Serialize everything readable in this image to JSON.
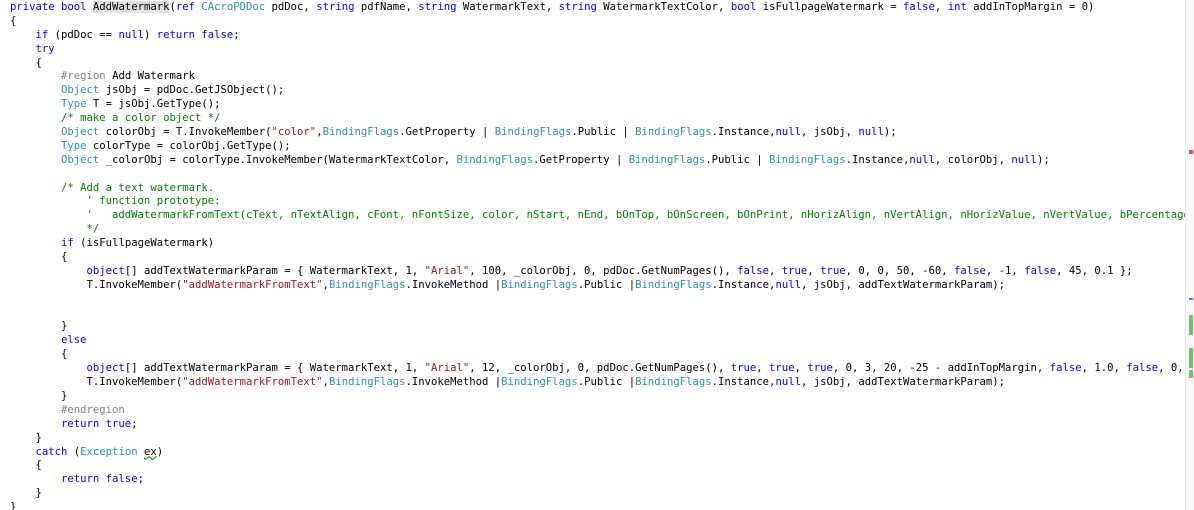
{
  "editor": {
    "lines": [
      [
        [
          "k",
          "private bool "
        ],
        [
          "h",
          "AddWatermark"
        ],
        [
          "p",
          "("
        ],
        [
          "k",
          "ref "
        ],
        [
          "t",
          "CAcroPDDoc"
        ],
        [
          "p",
          " pdDoc, "
        ],
        [
          "k",
          "string"
        ],
        [
          "p",
          " pdfName, "
        ],
        [
          "k",
          "string"
        ],
        [
          "p",
          " WatermarkText, "
        ],
        [
          "k",
          "string"
        ],
        [
          "p",
          " WatermarkTextColor, "
        ],
        [
          "k",
          "bool"
        ],
        [
          "p",
          " isFullpageWatermark = "
        ],
        [
          "k",
          "false"
        ],
        [
          "p",
          ", "
        ],
        [
          "k",
          "int"
        ],
        [
          "p",
          " addInTopMargin = 0)"
        ]
      ],
      [
        [
          "p",
          "{"
        ]
      ],
      [
        [
          "p",
          "    "
        ],
        [
          "k",
          "if"
        ],
        [
          "p",
          " (pdDoc == "
        ],
        [
          "k",
          "null"
        ],
        [
          "p",
          ") "
        ],
        [
          "k",
          "return false"
        ],
        [
          "p",
          ";"
        ]
      ],
      [
        [
          "p",
          "    "
        ],
        [
          "k",
          "try"
        ]
      ],
      [
        [
          "p",
          "    {"
        ]
      ],
      [
        [
          "p",
          "        "
        ],
        [
          "r",
          "#region"
        ],
        [
          "p",
          " Add Watermark"
        ]
      ],
      [
        [
          "p",
          "        "
        ],
        [
          "t",
          "Object"
        ],
        [
          "p",
          " jsObj = pdDoc.GetJSObject();"
        ]
      ],
      [
        [
          "p",
          "        "
        ],
        [
          "t",
          "Type"
        ],
        [
          "p",
          " T = jsObj.GetType();"
        ]
      ],
      [
        [
          "p",
          "        "
        ],
        [
          "c",
          "/* make a color object */"
        ]
      ],
      [
        [
          "p",
          "        "
        ],
        [
          "t",
          "Object"
        ],
        [
          "p",
          " colorObj = T.InvokeMember("
        ],
        [
          "s",
          "\"color\""
        ],
        [
          "p",
          ","
        ],
        [
          "t",
          "BindingFlags"
        ],
        [
          "p",
          ".GetProperty | "
        ],
        [
          "t",
          "BindingFlags"
        ],
        [
          "p",
          ".Public | "
        ],
        [
          "t",
          "BindingFlags"
        ],
        [
          "p",
          ".Instance,"
        ],
        [
          "k",
          "null"
        ],
        [
          "p",
          ", jsObj, "
        ],
        [
          "k",
          "null"
        ],
        [
          "p",
          ");"
        ]
      ],
      [
        [
          "p",
          "        "
        ],
        [
          "t",
          "Type"
        ],
        [
          "p",
          " colorType = colorObj.GetType();"
        ]
      ],
      [
        [
          "p",
          "        "
        ],
        [
          "t",
          "Object"
        ],
        [
          "p",
          " _colorObj = colorType.InvokeMember(WatermarkTextColor, "
        ],
        [
          "t",
          "BindingFlags"
        ],
        [
          "p",
          ".GetProperty | "
        ],
        [
          "t",
          "BindingFlags"
        ],
        [
          "p",
          ".Public | "
        ],
        [
          "t",
          "BindingFlags"
        ],
        [
          "p",
          ".Instance,"
        ],
        [
          "k",
          "null"
        ],
        [
          "p",
          ", colorObj, "
        ],
        [
          "k",
          "null"
        ],
        [
          "p",
          ");"
        ]
      ],
      [
        [
          "p",
          ""
        ]
      ],
      [
        [
          "p",
          "        "
        ],
        [
          "c",
          "/* Add a text watermark."
        ]
      ],
      [
        [
          "c",
          "            ' function prototype:"
        ]
      ],
      [
        [
          "c",
          "            '   addWatermarkFromText(cText, nTextAlign, cFont, nFontSize, color, nStart, nEnd, bOnTop, bOnScreen, bOnPrint, nHorizAlign, nVertAlign, nHorizValue, nVertValue, bPercentage, nScale, bFixedPrint, nRotation, nOpacity)"
        ]
      ],
      [
        [
          "c",
          "            */"
        ]
      ],
      [
        [
          "p",
          "        "
        ],
        [
          "k",
          "if"
        ],
        [
          "p",
          " (isFullpageWatermark)"
        ]
      ],
      [
        [
          "p",
          "        {"
        ]
      ],
      [
        [
          "p",
          "            "
        ],
        [
          "k",
          "object"
        ],
        [
          "p",
          "[] addTextWatermarkParam = { WatermarkText, 1, "
        ],
        [
          "s",
          "\"Arial\""
        ],
        [
          "p",
          ", 100, _colorObj, 0, pdDoc.GetNumPages(), "
        ],
        [
          "k",
          "false"
        ],
        [
          "p",
          ", "
        ],
        [
          "k",
          "true"
        ],
        [
          "p",
          ", "
        ],
        [
          "k",
          "true"
        ],
        [
          "p",
          ", 0, 0, 50, -60, "
        ],
        [
          "k",
          "false"
        ],
        [
          "p",
          ", -1, "
        ],
        [
          "k",
          "false"
        ],
        [
          "p",
          ", 45, 0.1 };"
        ]
      ],
      [
        [
          "p",
          "            T.InvokeMember("
        ],
        [
          "s",
          "\"addWatermarkFromText\""
        ],
        [
          "p",
          ","
        ],
        [
          "t",
          "BindingFlags"
        ],
        [
          "p",
          ".InvokeMethod |"
        ],
        [
          "t",
          "BindingFlags"
        ],
        [
          "p",
          ".Public |"
        ],
        [
          "t",
          "BindingFlags"
        ],
        [
          "p",
          ".Instance,"
        ],
        [
          "k",
          "null"
        ],
        [
          "p",
          ", jsObj, addTextWatermarkParam);"
        ]
      ],
      [
        [
          "p",
          ""
        ]
      ],
      [
        [
          "p",
          ""
        ]
      ],
      [
        [
          "p",
          "        }"
        ]
      ],
      [
        [
          "p",
          "        "
        ],
        [
          "k",
          "else"
        ]
      ],
      [
        [
          "p",
          "        {"
        ]
      ],
      [
        [
          "p",
          "            "
        ],
        [
          "k",
          "object"
        ],
        [
          "p",
          "[] addTextWatermarkParam = { WatermarkText, 1, "
        ],
        [
          "s",
          "\"Arial\""
        ],
        [
          "p",
          ", 12, _colorObj, 0, pdDoc.GetNumPages(), "
        ],
        [
          "k",
          "true"
        ],
        [
          "p",
          ", "
        ],
        [
          "k",
          "true"
        ],
        [
          "p",
          ", "
        ],
        [
          "k",
          "true"
        ],
        [
          "p",
          ", 0, 3, 20, -25 - addInTopMargin, "
        ],
        [
          "k",
          "false"
        ],
        [
          "p",
          ", 1.0, "
        ],
        [
          "k",
          "false"
        ],
        [
          "p",
          ", 0, 0.7 };"
        ]
      ],
      [
        [
          "p",
          "            T.InvokeMember("
        ],
        [
          "s",
          "\"addWatermarkFromText\""
        ],
        [
          "p",
          ","
        ],
        [
          "t",
          "BindingFlags"
        ],
        [
          "p",
          ".InvokeMethod |"
        ],
        [
          "t",
          "BindingFlags"
        ],
        [
          "p",
          ".Public |"
        ],
        [
          "t",
          "BindingFlags"
        ],
        [
          "p",
          ".Instance,"
        ],
        [
          "k",
          "null"
        ],
        [
          "p",
          ", jsObj, addTextWatermarkParam);"
        ]
      ],
      [
        [
          "p",
          "        }"
        ]
      ],
      [
        [
          "p",
          "        "
        ],
        [
          "r",
          "#endregion"
        ]
      ],
      [
        [
          "p",
          "        "
        ],
        [
          "k",
          "return true"
        ],
        [
          "p",
          ";"
        ]
      ],
      [
        [
          "p",
          "    }"
        ]
      ],
      [
        [
          "p",
          "    "
        ],
        [
          "k",
          "catch"
        ],
        [
          "p",
          " ("
        ],
        [
          "t",
          "Exception"
        ],
        [
          "p",
          " "
        ],
        [
          "u",
          "ex"
        ],
        [
          "p",
          ")"
        ]
      ],
      [
        [
          "p",
          "    {"
        ]
      ],
      [
        [
          "p",
          "        "
        ],
        [
          "k",
          "return false"
        ],
        [
          "p",
          ";"
        ]
      ],
      [
        [
          "p",
          "    }"
        ]
      ],
      [
        [
          "p",
          "}"
        ]
      ]
    ]
  },
  "overview_marks": [
    {
      "kind": "change-green",
      "color": "#70c070"
    },
    {
      "kind": "change-green",
      "color": "#70c070"
    },
    {
      "kind": "change-green",
      "color": "#70c070"
    },
    {
      "kind": "caret-blue",
      "color": "#4a7fd0"
    },
    {
      "kind": "error-red",
      "color": "#e05050"
    }
  ],
  "colors": {
    "keyword": "#0000ff",
    "type": "#2b91af",
    "string": "#a31515",
    "comment": "#008000",
    "preprocessor": "#808080",
    "highlight": "#e1e1e1"
  }
}
